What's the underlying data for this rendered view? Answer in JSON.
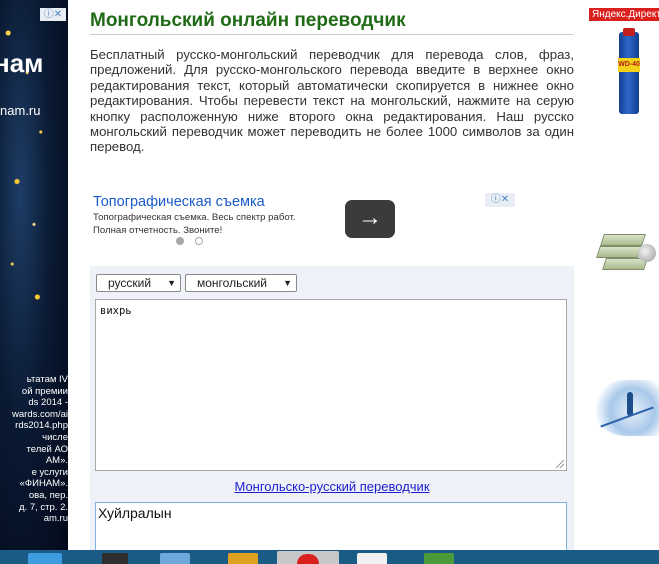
{
  "left_ad": {
    "brand_fragment": "нам",
    "domain_fragment": "nam.ru",
    "small_text_lines": [
      "ьтатам IV",
      "ой премии",
      "ds 2014 -",
      "wards.com/ai",
      "rds2014.php",
      "числе",
      "телей АО",
      "АМ».",
      "е услуги",
      "«ФИНАМ».",
      "ова, пер.",
      "д. 7, стр. 2.",
      "am.ru"
    ]
  },
  "main": {
    "title": "Монгольский онлайн переводчик",
    "description": "Бесплатный русско-монгольский переводчик для перевода слов, фраз, предложений. Для русско-монгольского перевода введите в верхнее окно редактирования текст, который автоматически скопируется в нижнее окно редактирования. Чтобы перевести текст на монгольский, нажмите на серую кнопку расположенную ниже второго окна редактирования. Наш русско монгольский переводчик может переводить не более 1000 символов за один перевод."
  },
  "inline_ad": {
    "title": "Топографическая съемка",
    "text": "Топографическая съемка. Весь спектр работ. Полная отчетность. Звоните!",
    "arrow": "→",
    "active_dot_color": "#a8a8a8"
  },
  "translator": {
    "source_language": "русский",
    "target_language": "монгольский",
    "source_text": "вихрь",
    "reverse_link": "Монгольско-русский переводчик",
    "output_text": "Хуйлралын"
  },
  "right_col": {
    "yandex_label": "Яндекс.Директ",
    "wd40_label": "WD-40"
  },
  "colors": {
    "title_green": "#1f6b16",
    "link_blue": "#1d1dcf",
    "ad_title_blue": "#1a5bc9",
    "yandex_red": "#d9201d",
    "taskbar": "#1b5c86"
  }
}
